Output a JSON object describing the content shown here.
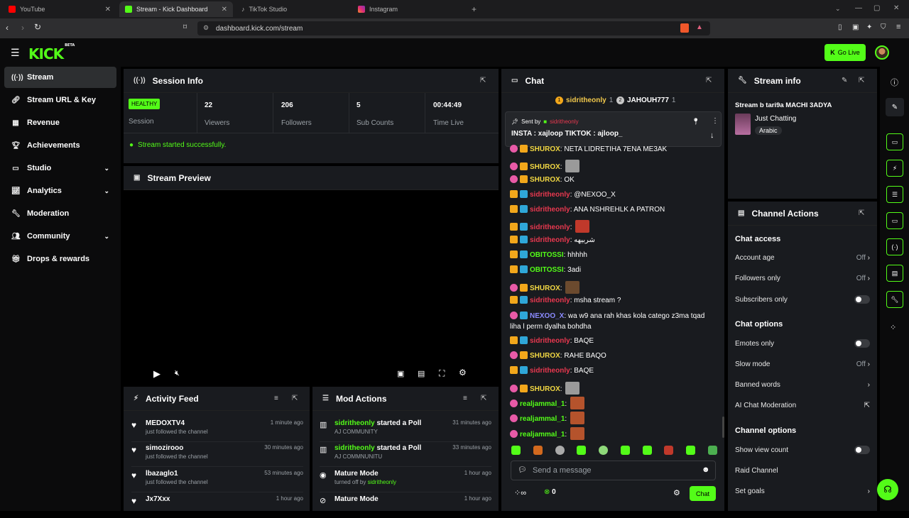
{
  "browser": {
    "tabs": [
      {
        "title": "YouTube",
        "color": "#ff0000"
      },
      {
        "title": "Stream - Kick Dashboard",
        "color": "#53fc18"
      },
      {
        "title": "TikTok Studio",
        "color": "#ffffff"
      },
      {
        "title": "Instagram",
        "color": "#e1306c"
      }
    ],
    "url": "dashboard.kick.com/stream"
  },
  "header": {
    "logo": "KICK",
    "logo_sup": "BETA",
    "go_live": "Go Live"
  },
  "sidebar": {
    "items": [
      {
        "label": "Stream",
        "icon": "broadcast-icon"
      },
      {
        "label": "Stream URL & Key",
        "icon": "link-icon"
      },
      {
        "label": "Revenue",
        "icon": "revenue-icon"
      },
      {
        "label": "Achievements",
        "icon": "trophy-icon"
      },
      {
        "label": "Studio",
        "icon": "studio-icon"
      },
      {
        "label": "Analytics",
        "icon": "analytics-icon"
      },
      {
        "label": "Moderation",
        "icon": "wrench-icon"
      },
      {
        "label": "Community",
        "icon": "community-icon"
      },
      {
        "label": "Drops & rewards",
        "icon": "drops-icon"
      }
    ]
  },
  "session": {
    "title": "Session Info",
    "status": "HEALTHY",
    "status_label": "Session",
    "stats": [
      {
        "value": "22",
        "label": "Viewers"
      },
      {
        "value": "206",
        "label": "Followers"
      },
      {
        "value": "5",
        "label": "Sub Counts"
      },
      {
        "value": "00:44:49",
        "label": "Time Live"
      }
    ],
    "message": "Stream started successfully."
  },
  "preview": {
    "title": "Stream Preview"
  },
  "activity": {
    "title": "Activity Feed",
    "items": [
      {
        "name": "MEDOXTV4",
        "action": "just followed the channel",
        "time": "1 minute ago"
      },
      {
        "name": "simozirooo",
        "action": "just followed the channel",
        "time": "30 minutes ago"
      },
      {
        "name": "lbazaglo1",
        "action": "just followed the channel",
        "time": "53 minutes ago"
      },
      {
        "name": "Jx7Xxx",
        "action": "",
        "time": "1 hour ago"
      }
    ]
  },
  "mod_actions": {
    "title": "Mod Actions",
    "items": [
      {
        "user": "sidritheonly",
        "action": " started a Poll",
        "sub": "AJ COMMUNITY",
        "time": "31 minutes ago"
      },
      {
        "user": "sidritheonly",
        "action": " started a Poll",
        "sub": "AJ COMMNUNITU",
        "time": "33 minutes ago"
      },
      {
        "user": "",
        "action": "Mature Mode",
        "sub": "turned off by ",
        "sub_user": "sidritheonly",
        "time": "1 hour ago"
      },
      {
        "user": "",
        "action": "Mature Mode",
        "sub": "",
        "time": "1 hour ago"
      }
    ]
  },
  "chat": {
    "title": "Chat",
    "top_gifters": [
      {
        "rank": "1",
        "name": "sidritheonly",
        "count": "1"
      },
      {
        "rank": "2",
        "name": "JAHOUH777",
        "count": "1"
      }
    ],
    "pinned": {
      "sent_by": "Sent by",
      "user": "sidritheonly",
      "text": "INSTA : xajloop TIKTOK : ajloop_"
    },
    "messages": [
      {
        "user": "SHUROX",
        "color": "#f2d843",
        "text": "NETA LIDRETIHA 7ENA ME3AK"
      },
      {
        "user": "SHUROX",
        "color": "#f2d843",
        "text": "",
        "emote": "#9a9a9a"
      },
      {
        "user": "SHUROX",
        "color": "#f2d843",
        "text": "OK"
      },
      {
        "user": "sidritheonly",
        "color": "#e8384f",
        "text": "@NEXOO_X"
      },
      {
        "user": "sidritheonly",
        "color": "#e8384f",
        "text": "ANA NSHREHLK A PATRON"
      },
      {
        "user": "sidritheonly",
        "color": "#e8384f",
        "text": "",
        "emote": "#c0392b"
      },
      {
        "user": "sidritheonly",
        "color": "#e8384f",
        "text": "شربيهه"
      },
      {
        "user": "OBITOSSI",
        "color": "#53fc18",
        "text": "hhhhh"
      },
      {
        "user": "OBITOSSI",
        "color": "#53fc18",
        "text": "3adi"
      },
      {
        "user": "SHUROX",
        "color": "#f2d843",
        "text": "",
        "emote": "#6b4a2e"
      },
      {
        "user": "sidritheonly",
        "color": "#e8384f",
        "text": "msha stream ?"
      },
      {
        "user": "NEXOO_X",
        "color": "#8b8bff",
        "text": "wa w9 ana rah khas kola catego z3ma tqad",
        "text2": "liha l perm dyalha bohdha"
      },
      {
        "user": "sidritheonly",
        "color": "#e8384f",
        "text": "BAQE"
      },
      {
        "user": "SHUROX",
        "color": "#f2d843",
        "text": "RAHE BAQO"
      },
      {
        "user": "sidritheonly",
        "color": "#e8384f",
        "text": "BAQE"
      },
      {
        "user": "SHUROX",
        "color": "#f2d843",
        "text": "",
        "emote": "#9a9a9a"
      },
      {
        "user": "realjammal_1",
        "color": "#53fc18",
        "text": "",
        "emote": "#b5532c"
      },
      {
        "user": "realjammal_1",
        "color": "#53fc18",
        "text": "",
        "emote": "#b5532c"
      },
      {
        "user": "realjammal_1",
        "color": "#53fc18",
        "text": "",
        "emote": "#b5532c"
      }
    ],
    "input_placeholder": "Send a message",
    "points": "0",
    "send": "Chat"
  },
  "stream_info": {
    "title": "Stream info",
    "stream_title": "Stream b tari9a MACHI 3ADYA",
    "category": "Just Chatting",
    "tag": "Arabic"
  },
  "channel_actions": {
    "title": "Channel Actions",
    "chat_access": "Chat access",
    "account_age": "Account age",
    "account_age_val": "Off",
    "followers_only": "Followers only",
    "followers_only_val": "Off",
    "subscribers_only": "Subscribers only",
    "chat_options": "Chat options",
    "emotes_only": "Emotes only",
    "slow_mode": "Slow mode",
    "slow_mode_val": "Off",
    "banned_words": "Banned words",
    "ai_moderation": "AI Chat Moderation",
    "channel_options": "Channel options",
    "show_view_count": "Show view count",
    "raid_channel": "Raid Channel",
    "set_goals": "Set goals"
  }
}
